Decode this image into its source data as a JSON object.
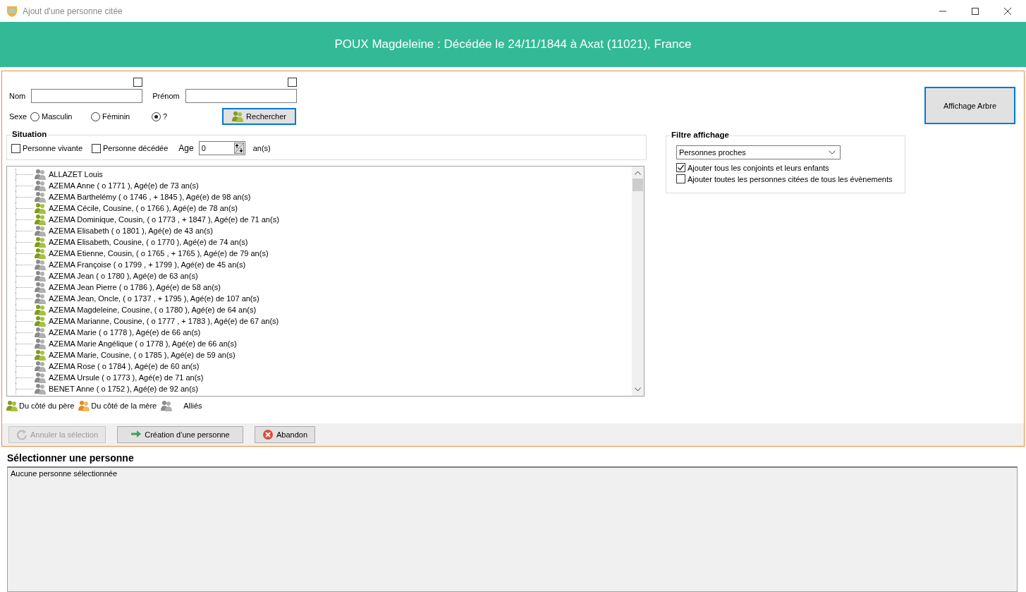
{
  "window": {
    "title": "Ajout d'une personne citée"
  },
  "header": {
    "text": "POUX Magdeleine : Décédée le 24/11/1844 à Axat (11021), France"
  },
  "search": {
    "fields": [
      {
        "label": "Nom",
        "checked": false
      },
      {
        "label": "Prénom",
        "checked": false
      }
    ],
    "sexe": {
      "label": "Sexe",
      "options": [
        {
          "label": "Masculin",
          "selected": false
        },
        {
          "label": "Féminin",
          "selected": false
        },
        {
          "label": "?",
          "selected": true
        }
      ]
    },
    "button": "Rechercher"
  },
  "situation": {
    "title": "Situation",
    "checks": [
      {
        "label": "Personne vivante",
        "checked": false
      },
      {
        "label": "Personne décédée",
        "checked": false
      }
    ],
    "age_label": "Age",
    "age_value": "0",
    "age_unit": "an(s)"
  },
  "persons": [
    {
      "text": "ALLAZET Louis",
      "kind": "ally"
    },
    {
      "text": "AZEMA Anne ( o 1771 ), Agé(e) de 73 an(s)",
      "kind": "ally"
    },
    {
      "text": "AZEMA Barthelémy ( o 1746 , + 1845 ), Agé(e) de 98 an(s)",
      "kind": "ally"
    },
    {
      "text": "AZEMA Cécile, Cousine, ( o 1766 ), Agé(e) de 78 an(s)",
      "kind": "father"
    },
    {
      "text": "AZEMA Dominique, Cousin, ( o 1773 , + 1847 ), Agé(e) de 71 an(s)",
      "kind": "father"
    },
    {
      "text": "AZEMA Elisabeth ( o 1801 ), Agé(e) de 43 an(s)",
      "kind": "ally"
    },
    {
      "text": "AZEMA Elisabeth, Cousine, ( o 1770 ), Agé(e) de 74 an(s)",
      "kind": "father"
    },
    {
      "text": "AZEMA Etienne, Cousin, ( o 1765 , + 1765 ), Agé(e) de 79 an(s)",
      "kind": "father"
    },
    {
      "text": "AZEMA Françoise ( o 1799 , + 1799 ), Agé(e) de 45 an(s)",
      "kind": "ally"
    },
    {
      "text": "AZEMA Jean ( o 1780 ), Agé(e) de 63 an(s)",
      "kind": "ally"
    },
    {
      "text": "AZEMA Jean Pierre ( o 1786 ), Agé(e) de 58 an(s)",
      "kind": "ally"
    },
    {
      "text": "AZEMA Jean, Oncle, ( o 1737 , + 1795 ), Agé(e) de 107 an(s)",
      "kind": "ally"
    },
    {
      "text": "AZEMA Magdeleine, Cousine, ( o 1780 ), Agé(e) de 64 an(s)",
      "kind": "father"
    },
    {
      "text": "AZEMA Marianne, Cousine, ( o 1777 , + 1783 ), Agé(e) de 67 an(s)",
      "kind": "father"
    },
    {
      "text": "AZEMA Marie ( o 1778 ), Agé(e) de 66 an(s)",
      "kind": "ally"
    },
    {
      "text": "AZEMA Marie Angélique ( o 1778 ), Agé(e) de 66 an(s)",
      "kind": "ally"
    },
    {
      "text": "AZEMA Marie, Cousine, ( o 1785 ), Agé(e) de 59 an(s)",
      "kind": "father"
    },
    {
      "text": "AZEMA Rose ( o 1784 ), Agé(e) de 60 an(s)",
      "kind": "ally"
    },
    {
      "text": "AZEMA Ursule ( o 1773 ), Agé(e) de 71 an(s)",
      "kind": "ally"
    },
    {
      "text": "BENET Anne ( o 1752 ), Agé(e) de 92 an(s)",
      "kind": "ally"
    }
  ],
  "legend": [
    {
      "label": "Du côté du père",
      "kind": "father"
    },
    {
      "label": "Du côté de la mère",
      "kind": "mother"
    },
    {
      "label": "Alliés",
      "kind": "ally"
    }
  ],
  "actions": [
    {
      "label": "Annuler la sélection",
      "kind": "undo",
      "disabled": true
    },
    {
      "label": "Création d’une personne",
      "kind": "create",
      "disabled": false
    },
    {
      "label": "Abandon",
      "kind": "cancel",
      "disabled": false
    }
  ],
  "tree_button": "Affichage Arbre",
  "filter": {
    "title": "Filtre affichage",
    "dropdown": "Personnes proches",
    "options": [
      {
        "label": "Ajouter tous les conjoints et leurs enfants",
        "checked": true
      },
      {
        "label": "Ajouter toutes les personnes citées de tous les évènements",
        "checked": false
      }
    ]
  },
  "selection": {
    "title": "Sélectionner une personne",
    "text": "Aucune personne sélectionnée"
  }
}
